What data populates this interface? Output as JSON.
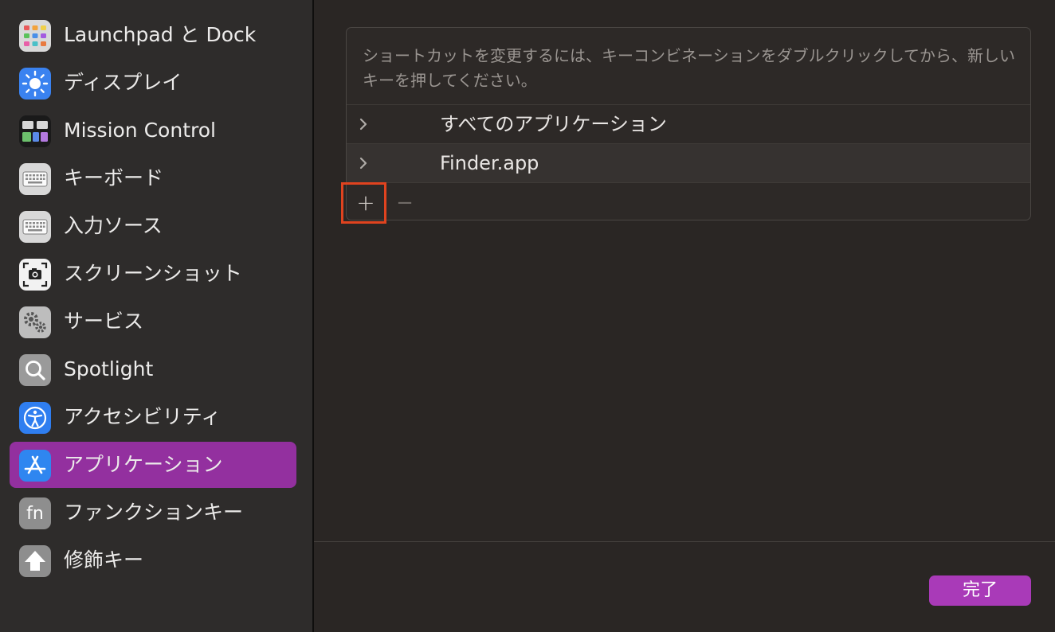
{
  "sidebar": {
    "items": [
      {
        "label": "Launchpad と Dock",
        "icon": "launchpad-icon",
        "selected": false
      },
      {
        "label": "ディスプレイ",
        "icon": "display-icon",
        "selected": false
      },
      {
        "label": "Mission Control",
        "icon": "mission-control-icon",
        "selected": false
      },
      {
        "label": "キーボード",
        "icon": "keyboard-icon",
        "selected": false
      },
      {
        "label": "入力ソース",
        "icon": "input-sources-icon",
        "selected": false
      },
      {
        "label": "スクリーンショット",
        "icon": "screenshot-icon",
        "selected": false
      },
      {
        "label": "サービス",
        "icon": "services-icon",
        "selected": false
      },
      {
        "label": "Spotlight",
        "icon": "spotlight-icon",
        "selected": false
      },
      {
        "label": "アクセシビリティ",
        "icon": "accessibility-icon",
        "selected": false
      },
      {
        "label": "アプリケーション",
        "icon": "app-store-icon",
        "selected": true
      },
      {
        "label": "ファンクションキー",
        "icon": "fn-key-icon",
        "selected": false,
        "icon_text": "fn"
      },
      {
        "label": "修飾キー",
        "icon": "modifier-keys-icon",
        "selected": false
      }
    ]
  },
  "main": {
    "description": "ショートカットを変更するには、キーコンビネーションをダブルクリックしてから、新しいキーを押してください。",
    "rows": [
      {
        "label": "すべてのアプリケーション"
      },
      {
        "label": "Finder.app"
      }
    ],
    "add_label": "+",
    "remove_label": "−",
    "done_label": "完了"
  },
  "colors": {
    "accent": "#93309f",
    "button": "#a93ab8",
    "highlight": "#e0431f"
  }
}
